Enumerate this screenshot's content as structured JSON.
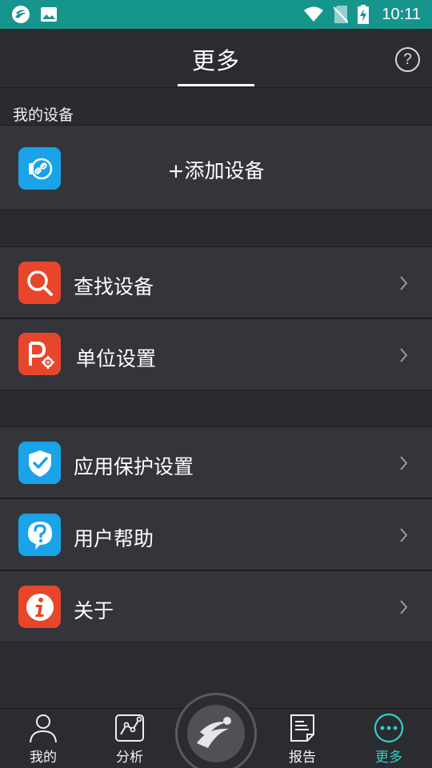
{
  "status_bar": {
    "time": "10:11"
  },
  "header": {
    "title": "更多",
    "help_glyph": "?"
  },
  "sections": {
    "my_devices_label": "我的设备"
  },
  "add_device": {
    "label": "+添加设备",
    "icon": "device-link-icon",
    "color": "#1aa3e8"
  },
  "menu_group_1": [
    {
      "label": "查找设备",
      "icon": "search-icon",
      "color": "#e8462a"
    },
    {
      "label": "单位设置",
      "icon": "units-settings-icon",
      "color": "#e8462a"
    }
  ],
  "menu_group_2": [
    {
      "label": "应用保护设置",
      "icon": "shield-check-icon",
      "color": "#1aa3e8"
    },
    {
      "label": "用户帮助",
      "icon": "help-bubble-icon",
      "color": "#1aa3e8"
    },
    {
      "label": "关于",
      "icon": "info-icon",
      "color": "#e8462a"
    }
  ],
  "bottom_nav": [
    {
      "label": "我的",
      "icon": "person-icon",
      "active": false
    },
    {
      "label": "分析",
      "icon": "chart-icon",
      "active": false
    },
    {
      "label": "报告",
      "icon": "report-icon",
      "active": false
    },
    {
      "label": "更多",
      "icon": "more-icon",
      "active": true
    }
  ],
  "colors": {
    "accent": "#2fd0c9",
    "status_bar": "#16958c",
    "background": "#2b2c30",
    "row": "#33353a"
  }
}
